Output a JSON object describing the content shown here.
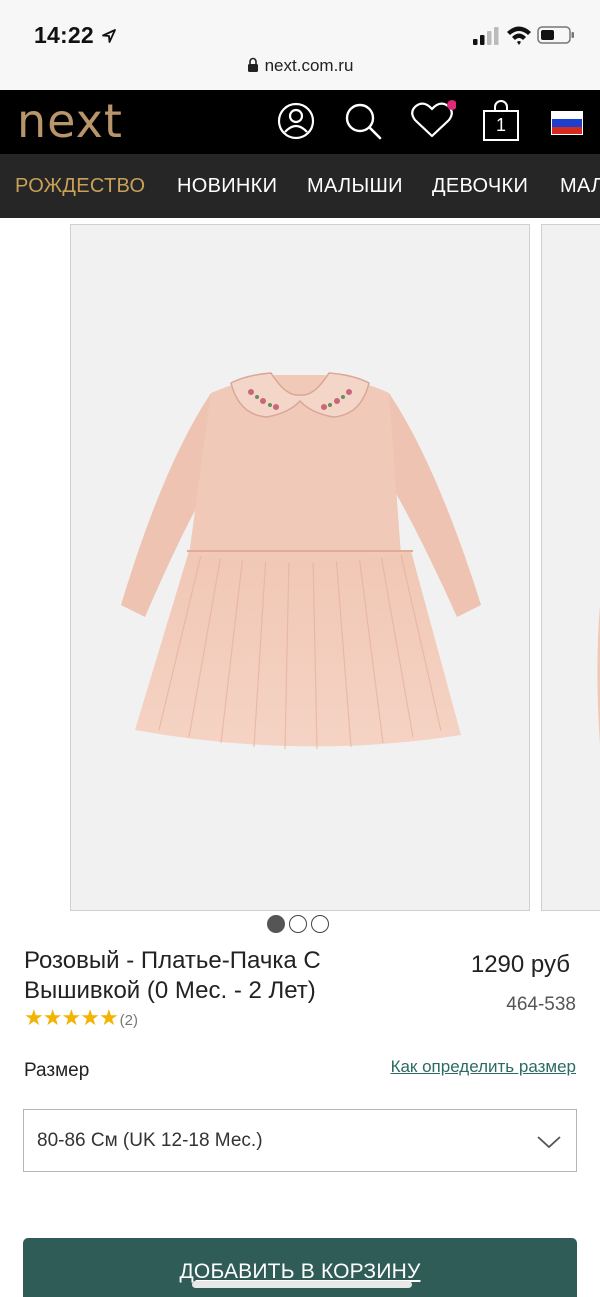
{
  "status_bar": {
    "time": "14:22",
    "url": "next.com.ru"
  },
  "header": {
    "logo": "next",
    "icons": [
      "account-icon",
      "search-icon",
      "wishlist-icon",
      "bag-icon",
      "russia-flag-icon"
    ],
    "bag_count": "1",
    "wishlist_dot_color": "#e0297a",
    "logo_color": "#b8956a"
  },
  "nav": {
    "items": [
      {
        "label": "РОЖДЕСТВО",
        "active": true
      },
      {
        "label": "НОВИНКИ"
      },
      {
        "label": "МАЛЫШИ"
      },
      {
        "label": "ДЕВОЧКИ"
      },
      {
        "label": "МАЛ"
      }
    ],
    "active_color": "#c9a058"
  },
  "gallery": {
    "total_images": 3,
    "current_index": 1
  },
  "product": {
    "title": "Розовый - Платье-Пачка С Вышивкой (0 Мес. - 2 Лет)",
    "price": "1290 руб",
    "sku": "464-538",
    "rating_stars": 5,
    "reviews": "(2)"
  },
  "size": {
    "label": "Размер",
    "guide_link": "Как определить размер",
    "selected_value": "80-86 См (UK 12-18 Мес.)"
  },
  "actions": {
    "add_to_cart": "ДОБАВИТЬ В КОРЗИНУ",
    "button_color": "#2f5c57"
  }
}
